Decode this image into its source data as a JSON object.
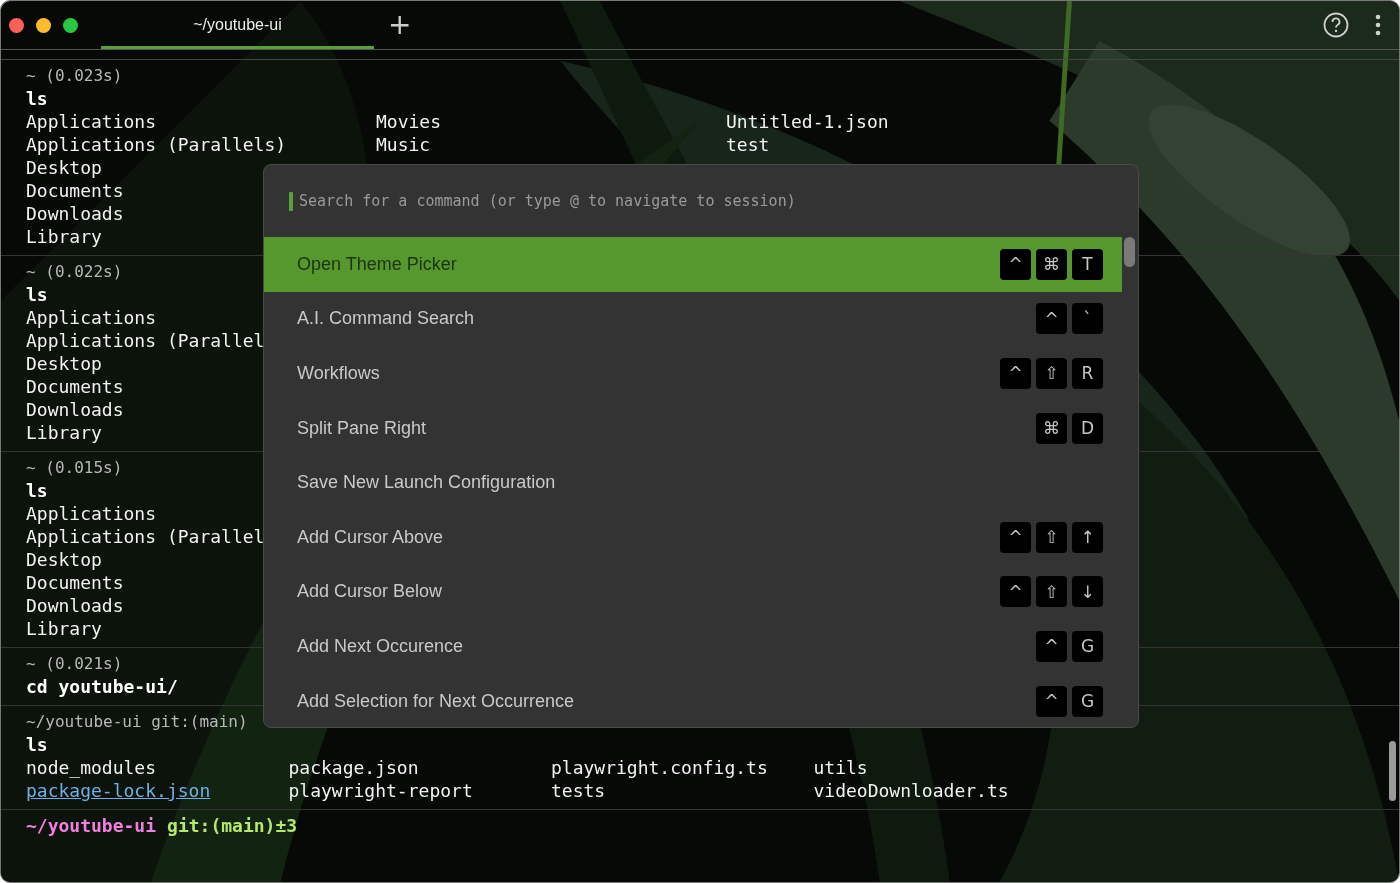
{
  "window": {
    "tabs": [
      {
        "label": "~/youtube-ui",
        "selected": true
      }
    ],
    "new_tab": "+"
  },
  "terminal": {
    "blocks": [
      {
        "header": "~ (0.023s)",
        "command": "ls",
        "columns": [
          [
            {
              "name": "Applications",
              "link": false
            },
            {
              "name": "Applications (Parallels)",
              "link": false
            },
            {
              "name": "Desktop",
              "link": false
            },
            {
              "name": "Documents",
              "link": false
            },
            {
              "name": "Downloads",
              "link": false
            },
            {
              "name": "Library",
              "link": false
            }
          ],
          [
            {
              "name": "Movies",
              "link": false
            },
            {
              "name": "Music",
              "link": false
            }
          ],
          [
            {
              "name": "Untitled-1.json",
              "link": false
            },
            {
              "name": "test",
              "link": false
            }
          ]
        ]
      },
      {
        "header": "~ (0.022s)",
        "command": "ls",
        "columns": [
          [
            {
              "name": "Applications",
              "link": false
            },
            {
              "name": "Applications (Parallel",
              "link": false
            },
            {
              "name": "Desktop",
              "link": false
            },
            {
              "name": "Documents",
              "link": false
            },
            {
              "name": "Downloads",
              "link": false
            },
            {
              "name": "Library",
              "link": false
            }
          ]
        ]
      },
      {
        "header": "~ (0.015s)",
        "command": "ls",
        "columns": [
          [
            {
              "name": "Applications",
              "link": false
            },
            {
              "name": "Applications (Parallel",
              "link": false
            },
            {
              "name": "Desktop",
              "link": false
            },
            {
              "name": "Documents",
              "link": false
            },
            {
              "name": "Downloads",
              "link": false
            },
            {
              "name": "Library",
              "link": false
            }
          ]
        ]
      },
      {
        "header": "~ (0.021s)",
        "command": "cd youtube-ui/"
      },
      {
        "header": "~/youtube-ui git:(main)",
        "command": "ls",
        "columns": [
          [
            {
              "name": "node_modules",
              "link": false
            },
            {
              "name": "package-lock.json",
              "link": true
            }
          ],
          [
            {
              "name": "package.json",
              "link": false
            },
            {
              "name": "playwright-report",
              "link": false
            }
          ],
          [
            {
              "name": "playwright.config.ts",
              "link": false
            },
            {
              "name": "tests",
              "link": false
            }
          ],
          [
            {
              "name": "utils",
              "link": false
            },
            {
              "name": "videoDownloader.ts",
              "link": false
            }
          ]
        ]
      }
    ],
    "prompt": {
      "path": "~/youtube-ui",
      "git": "git:(main)±3"
    }
  },
  "command_palette": {
    "placeholder": "Search for a command (or type @ to navigate to session)",
    "items": [
      {
        "label": "Open Theme Picker",
        "selected": true,
        "keys": [
          "^",
          "⌘",
          "T"
        ]
      },
      {
        "label": "A.I. Command Search",
        "selected": false,
        "keys": [
          "^",
          "`"
        ]
      },
      {
        "label": "Workflows",
        "selected": false,
        "keys": [
          "^",
          "⇧",
          "R"
        ]
      },
      {
        "label": "Split Pane Right",
        "selected": false,
        "keys": [
          "⌘",
          "D"
        ]
      },
      {
        "label": "Save New Launch Configuration",
        "selected": false
      },
      {
        "label": "Add Cursor Above",
        "selected": false,
        "keys": [
          "^",
          "⇧",
          "↑"
        ]
      },
      {
        "label": "Add Cursor Below",
        "selected": false,
        "keys": [
          "^",
          "⇧",
          "↓"
        ]
      },
      {
        "label": "Add Next Occurence",
        "selected": false,
        "keys": [
          "^",
          "G"
        ]
      },
      {
        "label": "Add Selection for Next Occurrence",
        "selected": false,
        "keys": [
          "^",
          "G"
        ]
      }
    ]
  }
}
